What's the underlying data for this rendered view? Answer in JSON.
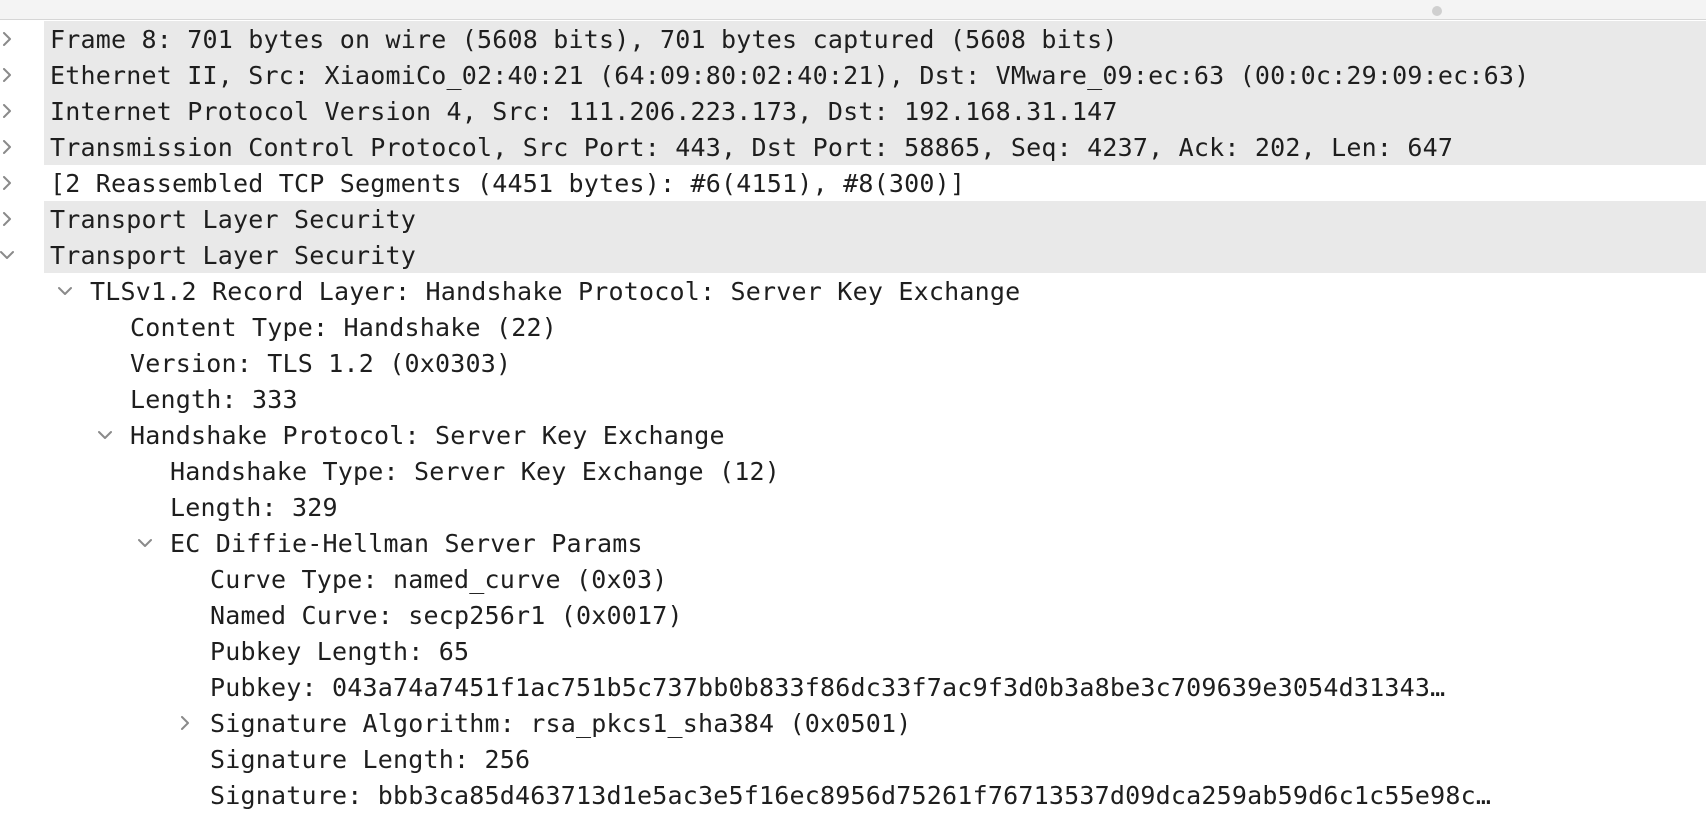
{
  "rows": [
    {
      "text": "Frame 8: 701 bytes on wire (5608 bits), 701 bytes captured (5608 bits)",
      "icon": "chevron-right-icon"
    },
    {
      "text": "Ethernet II, Src: XiaomiCo_02:40:21 (64:09:80:02:40:21), Dst: VMware_09:ec:63 (00:0c:29:09:ec:63)",
      "icon": "chevron-right-icon"
    },
    {
      "text": "Internet Protocol Version 4, Src: 111.206.223.173, Dst: 192.168.31.147",
      "icon": "chevron-right-icon"
    },
    {
      "text": "Transmission Control Protocol, Src Port: 443, Dst Port: 58865, Seq: 4237, Ack: 202, Len: 647",
      "icon": "chevron-right-icon"
    },
    {
      "text": "[2 Reassembled TCP Segments (4451 bytes): #6(4151), #8(300)]",
      "icon": "chevron-right-icon"
    },
    {
      "text": "Transport Layer Security",
      "icon": "chevron-right-icon"
    },
    {
      "text": "Transport Layer Security",
      "icon": "chevron-down-icon"
    },
    {
      "text": "TLSv1.2 Record Layer: Handshake Protocol: Server Key Exchange",
      "icon": "chevron-down-icon"
    },
    {
      "text": "Content Type: Handshake (22)"
    },
    {
      "text": "Version: TLS 1.2 (0x0303)"
    },
    {
      "text": "Length: 333"
    },
    {
      "text": "Handshake Protocol: Server Key Exchange",
      "icon": "chevron-down-icon"
    },
    {
      "text": "Handshake Type: Server Key Exchange (12)"
    },
    {
      "text": "Length: 329"
    },
    {
      "text": "EC Diffie-Hellman Server Params",
      "icon": "chevron-down-icon"
    },
    {
      "text": "Curve Type: named_curve (0x03)"
    },
    {
      "text": "Named Curve: secp256r1 (0x0017)"
    },
    {
      "text": "Pubkey Length: 65"
    },
    {
      "text": "Pubkey: 043a74a7451f1ac751b5c737bb0b833f86dc33f7ac9f3d0b3a8be3c709639e3054d31343…"
    },
    {
      "text": "Signature Algorithm: rsa_pkcs1_sha384 (0x0501)",
      "icon": "chevron-right-icon"
    },
    {
      "text": "Signature Length: 256"
    },
    {
      "text": "Signature: bbb3ca85d463713d1e5ac3e5f16ec8956d75261f76713537d09dca259ab59d6c1c55e98c…"
    }
  ]
}
